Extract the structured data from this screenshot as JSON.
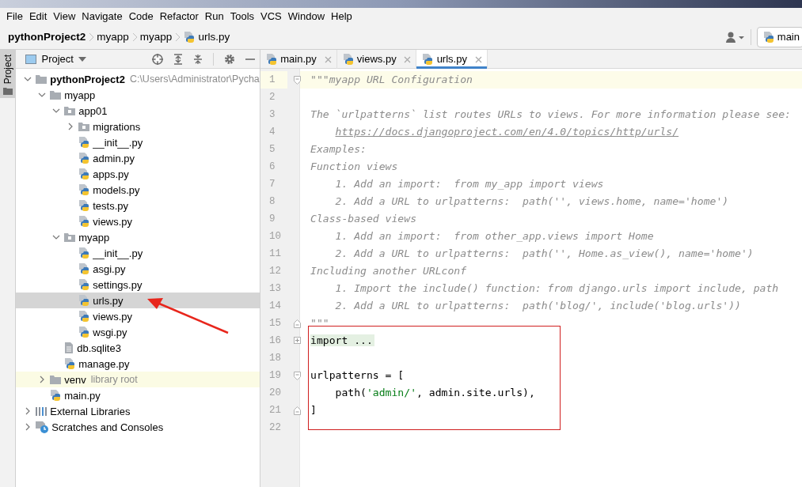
{
  "menu": [
    "File",
    "Edit",
    "View",
    "Navigate",
    "Code",
    "Refactor",
    "Run",
    "Tools",
    "VCS",
    "Window",
    "Help"
  ],
  "breadcrumb": [
    {
      "text": "pythonProject2",
      "kind": "project"
    },
    {
      "text": "myapp",
      "kind": "folder"
    },
    {
      "text": "myapp",
      "kind": "folder"
    },
    {
      "text": "urls.py",
      "kind": "python"
    }
  ],
  "run_config": {
    "label": "main"
  },
  "side_strip": {
    "label": "Project",
    "selected": true
  },
  "project_panel": {
    "title": "Project",
    "tree": [
      {
        "label": "pythonProject2",
        "kind": "project",
        "hint": "C:\\Users\\Administrator\\Pycha",
        "expanded": true,
        "selected": false,
        "children": [
          {
            "label": "myapp",
            "kind": "folder",
            "expanded": true,
            "selected": false,
            "children": [
              {
                "label": "app01",
                "kind": "module",
                "expanded": true,
                "selected": false,
                "children": [
                  {
                    "label": "migrations",
                    "kind": "module",
                    "expanded": false,
                    "selected": false
                  },
                  {
                    "label": "__init__.py",
                    "kind": "python",
                    "selected": false
                  },
                  {
                    "label": "admin.py",
                    "kind": "python",
                    "selected": false
                  },
                  {
                    "label": "apps.py",
                    "kind": "python",
                    "selected": false
                  },
                  {
                    "label": "models.py",
                    "kind": "python",
                    "selected": false
                  },
                  {
                    "label": "tests.py",
                    "kind": "python",
                    "selected": false
                  },
                  {
                    "label": "views.py",
                    "kind": "python",
                    "selected": false
                  }
                ]
              },
              {
                "label": "myapp",
                "kind": "module",
                "expanded": true,
                "selected": false,
                "children": [
                  {
                    "label": "__init__.py",
                    "kind": "python",
                    "selected": false
                  },
                  {
                    "label": "asgi.py",
                    "kind": "python",
                    "selected": false
                  },
                  {
                    "label": "settings.py",
                    "kind": "python",
                    "selected": false
                  },
                  {
                    "label": "urls.py",
                    "kind": "python",
                    "selected": true
                  },
                  {
                    "label": "views.py",
                    "kind": "python",
                    "selected": false
                  },
                  {
                    "label": "wsgi.py",
                    "kind": "python",
                    "selected": false
                  }
                ]
              },
              {
                "label": "db.sqlite3",
                "kind": "text",
                "selected": false
              },
              {
                "label": "manage.py",
                "kind": "python",
                "selected": false
              }
            ]
          },
          {
            "label": "venv",
            "kind": "library",
            "hint": "library root",
            "expanded": false,
            "selected": false
          },
          {
            "label": "main.py",
            "kind": "python",
            "selected": false
          }
        ]
      },
      {
        "label": "External Libraries",
        "kind": "libraries",
        "expanded": false,
        "selected": false
      },
      {
        "label": "Scratches and Consoles",
        "kind": "scratches",
        "expanded": false,
        "selected": false
      }
    ]
  },
  "tabs": [
    {
      "label": "main.py",
      "selected": false
    },
    {
      "label": "views.py",
      "selected": false
    },
    {
      "label": "urls.py",
      "selected": true
    }
  ],
  "code": [
    {
      "number": "1",
      "current": true,
      "fold_marker": {
        "kind": "open"
      },
      "segments": [
        {
          "kind": "comment",
          "text": "\"\"\"myapp URL Configuration"
        }
      ]
    },
    {
      "number": "2",
      "current": false
    },
    {
      "number": "3",
      "current": false,
      "segments": [
        {
          "kind": "comment",
          "text": "The `urlpatterns` list routes URLs to views. For more information please see:"
        }
      ]
    },
    {
      "number": "4",
      "current": false,
      "segments": [
        {
          "kind": "link",
          "text": "https://docs.djangoproject.com/en/4.0/topics/http/urls/"
        }
      ]
    },
    {
      "number": "5",
      "current": false,
      "segments": [
        {
          "kind": "comment",
          "text": "Examples:"
        }
      ]
    },
    {
      "number": "6",
      "current": false,
      "segments": [
        {
          "kind": "comment",
          "text": "Function views"
        }
      ]
    },
    {
      "number": "7",
      "current": false,
      "segments": [
        {
          "kind": "comment",
          "text": "    1. Add an import:  from my_app import views"
        }
      ]
    },
    {
      "number": "8",
      "current": false,
      "segments": [
        {
          "kind": "comment",
          "text": "    2. Add a URL to urlpatterns:  path('', views.home, name='home')"
        }
      ]
    },
    {
      "number": "9",
      "current": false,
      "segments": [
        {
          "kind": "comment",
          "text": "Class-based views"
        }
      ]
    },
    {
      "number": "10",
      "current": false,
      "segments": [
        {
          "kind": "comment",
          "text": "    1. Add an import:  from other_app.views import Home"
        }
      ]
    },
    {
      "number": "11",
      "current": false,
      "segments": [
        {
          "kind": "comment",
          "text": "    2. Add a URL to urlpatterns:  path('', Home.as_view(), name='home')"
        }
      ]
    },
    {
      "number": "12",
      "current": false,
      "segments": [
        {
          "kind": "comment",
          "text": "Including another URLconf"
        }
      ]
    },
    {
      "number": "13",
      "current": false,
      "segments": [
        {
          "kind": "comment",
          "text": "    1. Import the include() function: from django.urls import include, path"
        }
      ]
    },
    {
      "number": "14",
      "current": false,
      "segments": [
        {
          "kind": "comment",
          "text": "    2. Add a URL to urlpatterns:  path('blog/', include('blog.urls'))"
        }
      ]
    },
    {
      "number": "15",
      "current": false,
      "fold_marker": {
        "kind": "close"
      },
      "segments": [
        {
          "kind": "comment",
          "text": "\"\"\""
        }
      ]
    },
    {
      "number": "16",
      "current": false,
      "fold_marker": {
        "kind": "collapsed"
      },
      "segments": [
        {
          "kind": "folded",
          "text": "import ..."
        }
      ]
    },
    {
      "number": "18",
      "current": false
    },
    {
      "number": "19",
      "current": false,
      "fold_marker": {
        "kind": "open"
      },
      "segments": [
        {
          "kind": "plain",
          "text": "urlpatterns = ["
        }
      ]
    },
    {
      "number": "20",
      "current": false,
      "segments": [
        {
          "kind": "plain",
          "text": "    path("
        },
        {
          "kind": "string",
          "text": "'admin/'"
        },
        {
          "kind": "plain",
          "text": ", admin.site.urls),"
        }
      ]
    },
    {
      "number": "21",
      "current": false,
      "fold_marker": {
        "kind": "close"
      },
      "segments": [
        {
          "kind": "plain",
          "text": "]"
        }
      ]
    },
    {
      "number": "22",
      "current": false
    }
  ]
}
